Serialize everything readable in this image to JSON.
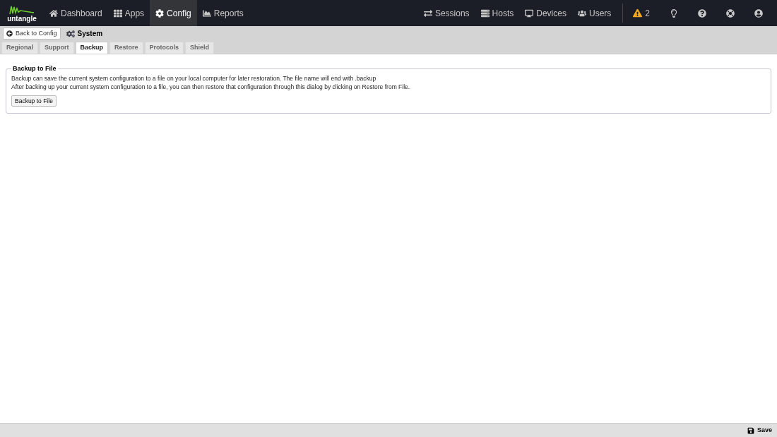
{
  "logo": {
    "text": "untangle"
  },
  "nav": [
    {
      "label": "Dashboard",
      "selected": false
    },
    {
      "label": "Apps",
      "selected": false
    },
    {
      "label": "Config",
      "selected": true
    },
    {
      "label": "Reports",
      "selected": false
    }
  ],
  "right_nav": [
    {
      "label": "Sessions"
    },
    {
      "label": "Hosts"
    },
    {
      "label": "Devices"
    },
    {
      "label": "Users"
    }
  ],
  "alerts": {
    "count": "2"
  },
  "back_button": "Back to Config",
  "page_title": "System",
  "tabs": [
    {
      "label": "Regional",
      "selected": false
    },
    {
      "label": "Support",
      "selected": false
    },
    {
      "label": "Backup",
      "selected": true
    },
    {
      "label": "Restore",
      "selected": false
    },
    {
      "label": "Protocols",
      "selected": false
    },
    {
      "label": "Shield",
      "selected": false
    }
  ],
  "fieldset": {
    "legend": "Backup to File",
    "lines": [
      "Backup can save the current system configuration to a file on your local computer for later restoration. The file name will end with .backup",
      "After backing up your current system configuration to a file, you can then restore that configuration through this dialog by clicking on Restore from File."
    ],
    "button": "Backup to File"
  },
  "footer": {
    "save": "Save"
  }
}
